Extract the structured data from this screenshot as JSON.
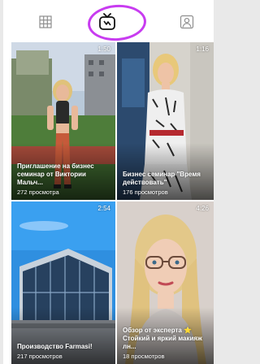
{
  "tabs": [
    {
      "id": "grid",
      "icon": "grid-icon"
    },
    {
      "id": "igtv",
      "icon": "igtv-icon",
      "selected": true
    },
    {
      "id": "tagged",
      "icon": "tagged-person-icon"
    }
  ],
  "highlight_color": "#c83cf0",
  "videos": [
    {
      "duration": "1:50",
      "title": "Приглашение на бизнес семинар от Виктории Мальч...",
      "views": "272 просмотра"
    },
    {
      "duration": "1:16",
      "title": "Бизнес семинар \"Время действовать\"",
      "views": "176 просмотров"
    },
    {
      "duration": "2:54",
      "title": "Производство Farmasi!",
      "views": "217 просмотров"
    },
    {
      "duration": "4:26",
      "title": "Обзор от эксперта ⭐ Стойкий и яркий макияж лн...",
      "views": "18 просмотров"
    }
  ]
}
